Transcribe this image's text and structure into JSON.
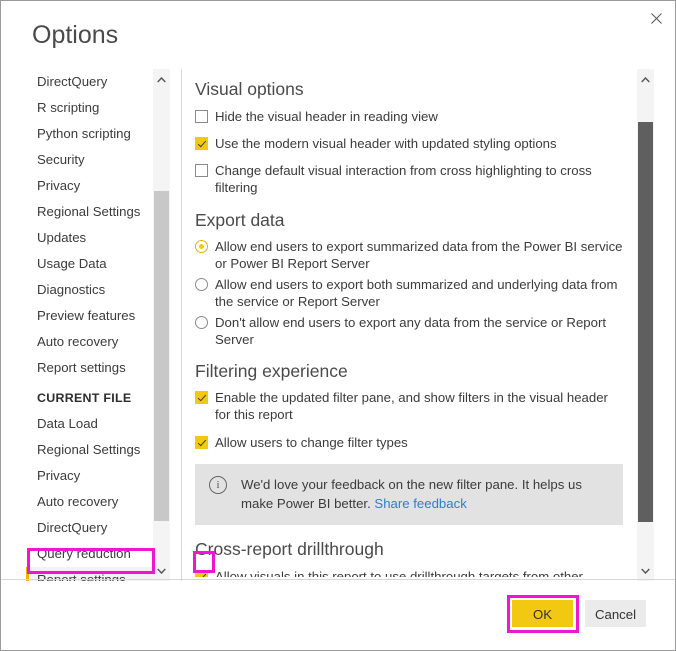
{
  "window": {
    "title": "Options",
    "close_icon": "close-icon"
  },
  "sidebar": {
    "items": [
      {
        "label": "DirectQuery"
      },
      {
        "label": "R scripting"
      },
      {
        "label": "Python scripting"
      },
      {
        "label": "Security"
      },
      {
        "label": "Privacy"
      },
      {
        "label": "Regional Settings"
      },
      {
        "label": "Updates"
      },
      {
        "label": "Usage Data"
      },
      {
        "label": "Diagnostics"
      },
      {
        "label": "Preview features"
      },
      {
        "label": "Auto recovery"
      },
      {
        "label": "Report settings"
      }
    ],
    "group_label": "CURRENT FILE",
    "current_file_items": [
      {
        "label": "Data Load"
      },
      {
        "label": "Regional Settings"
      },
      {
        "label": "Privacy"
      },
      {
        "label": "Auto recovery"
      },
      {
        "label": "DirectQuery"
      },
      {
        "label": "Query reduction"
      },
      {
        "label": "Report settings",
        "selected": true
      }
    ]
  },
  "main": {
    "visual_options": {
      "heading": "Visual options",
      "checkboxes": [
        {
          "label": "Hide the visual header in reading view",
          "checked": false
        },
        {
          "label": "Use the modern visual header with updated styling options",
          "checked": true
        },
        {
          "label": "Change default visual interaction from cross highlighting to cross filtering",
          "checked": false
        }
      ]
    },
    "export_data": {
      "heading": "Export data",
      "radios": [
        {
          "label": "Allow end users to export summarized data from the Power BI service or Power BI Report Server",
          "selected": true
        },
        {
          "label": "Allow end users to export both summarized and underlying data from the service or Report Server",
          "selected": false
        },
        {
          "label": "Don't allow end users to export any data from the service or Report Server",
          "selected": false
        }
      ]
    },
    "filtering_experience": {
      "heading": "Filtering experience",
      "checkboxes": [
        {
          "label": "Enable the updated filter pane, and show filters in the visual header for this report",
          "checked": true
        },
        {
          "label": "Allow users to change filter types",
          "checked": true
        }
      ],
      "info": {
        "icon": "info-circle-icon",
        "text": "We'd love your feedback on the new filter pane. It helps us make Power BI better. ",
        "link_text": "Share feedback"
      }
    },
    "cross_report_drillthrough": {
      "heading": "Cross-report drillthrough",
      "checkbox": {
        "label": "Allow visuals in this report to use drillthrough targets from other reports",
        "checked": true
      }
    }
  },
  "footer": {
    "ok_label": "OK",
    "cancel_label": "Cancel"
  },
  "colors": {
    "accent_yellow": "#f2c811",
    "annotation_magenta": "#ef16d2",
    "link_blue": "#2d7dd2"
  }
}
